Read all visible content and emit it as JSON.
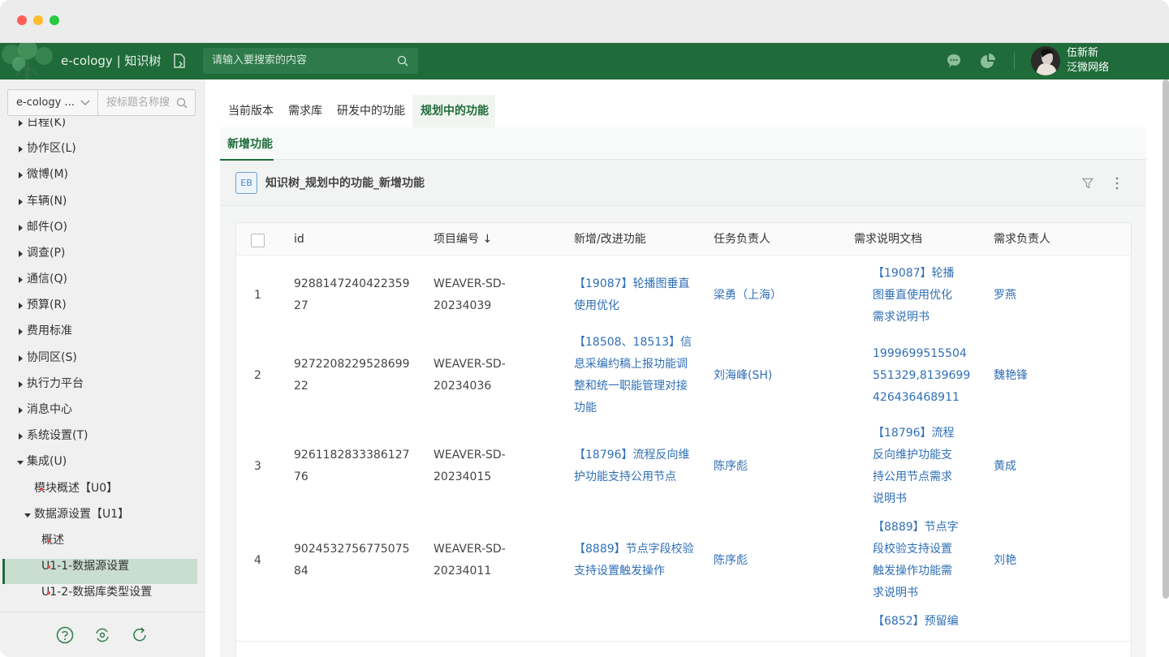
{
  "header": {
    "brand": "e-cology | 知识树",
    "search_placeholder": "请输入要搜索的内容",
    "user_name": "伍新新",
    "user_company": "泛微网络"
  },
  "sidebar": {
    "select_value": "e-cology ...",
    "search_placeholder": "按标题名称搜",
    "items": [
      {
        "label": "日程(K)",
        "expanded": false
      },
      {
        "label": "协作区(L)",
        "expanded": false
      },
      {
        "label": "微博(M)",
        "expanded": false
      },
      {
        "label": "车辆(N)",
        "expanded": false
      },
      {
        "label": "邮件(O)",
        "expanded": false
      },
      {
        "label": "调查(P)",
        "expanded": false
      },
      {
        "label": "通信(Q)",
        "expanded": false
      },
      {
        "label": "预算(R)",
        "expanded": false
      },
      {
        "label": "费用标准",
        "expanded": false
      },
      {
        "label": "协同区(S)",
        "expanded": false
      },
      {
        "label": "执行力平台",
        "expanded": false
      },
      {
        "label": "消息中心",
        "expanded": false
      },
      {
        "label": "系统设置(T)",
        "expanded": false
      },
      {
        "label": "集成(U)",
        "expanded": true
      },
      {
        "label": "模块概述【U0】",
        "dot": true
      },
      {
        "label": "数据源设置【U1】",
        "expanded": true
      },
      {
        "label": "概述",
        "dot": true
      },
      {
        "label": "U1-1-数据源设置",
        "dot": true,
        "selected": true
      },
      {
        "label": "U1-2-数据库类型设置",
        "dot": true
      }
    ]
  },
  "tabs": [
    {
      "label": "当前版本"
    },
    {
      "label": "需求库"
    },
    {
      "label": "研发中的功能"
    },
    {
      "label": "规划中的功能",
      "active": true
    }
  ],
  "subtab": "新增功能",
  "card": {
    "badge": "EB",
    "title": "知识树_规划中的功能_新增功能"
  },
  "table": {
    "columns": [
      "id",
      "项目编号 ↓",
      "新增/改进功能",
      "任务负责人",
      "需求说明文档",
      "需求负责人"
    ],
    "rows": [
      {
        "idx": "1",
        "id": [
          "9288147240422359",
          "27"
        ],
        "proj": [
          "WEAVER-SD-",
          "20234039"
        ],
        "feature": [
          "【19087】轮播图垂直",
          "使用优化"
        ],
        "owner": "梁勇（上海）",
        "doc": [
          "【19087】轮播",
          "图垂直使用优化",
          "需求说明书"
        ],
        "req_owner": "罗燕"
      },
      {
        "idx": "2",
        "id": [
          "9272208229528699",
          "22"
        ],
        "proj": [
          "WEAVER-SD-",
          "20234036"
        ],
        "feature": [
          "【18508、18513】信",
          "息采编约稿上报功能调",
          "整和统一职能管理对接",
          "功能"
        ],
        "owner": "刘海峰(SH)",
        "doc": [
          "1999699515504",
          "551329,8139699",
          "426436468911"
        ],
        "req_owner": "魏艳锋"
      },
      {
        "idx": "3",
        "id": [
          "9261182833386127",
          "76"
        ],
        "proj": [
          "WEAVER-SD-",
          "20234015"
        ],
        "feature": [
          "【18796】流程反向维",
          "护功能支持公用节点"
        ],
        "owner": "陈序彪",
        "doc": [
          "【18796】流程",
          "反向维护功能支",
          "持公用节点需求",
          "说明书"
        ],
        "req_owner": "黄成"
      },
      {
        "idx": "4",
        "id": [
          "9024532756775075",
          "84"
        ],
        "proj": [
          "WEAVER-SD-",
          "20234011"
        ],
        "feature": [
          "【8889】节点字段校验",
          "支持设置触发操作"
        ],
        "owner": "陈序彪",
        "doc": [
          "【8889】节点字",
          "段校验支持设置",
          "触发操作功能需",
          "求说明书"
        ],
        "req_owner": "刘艳"
      }
    ],
    "partial_doc": "【6852】预留编"
  }
}
